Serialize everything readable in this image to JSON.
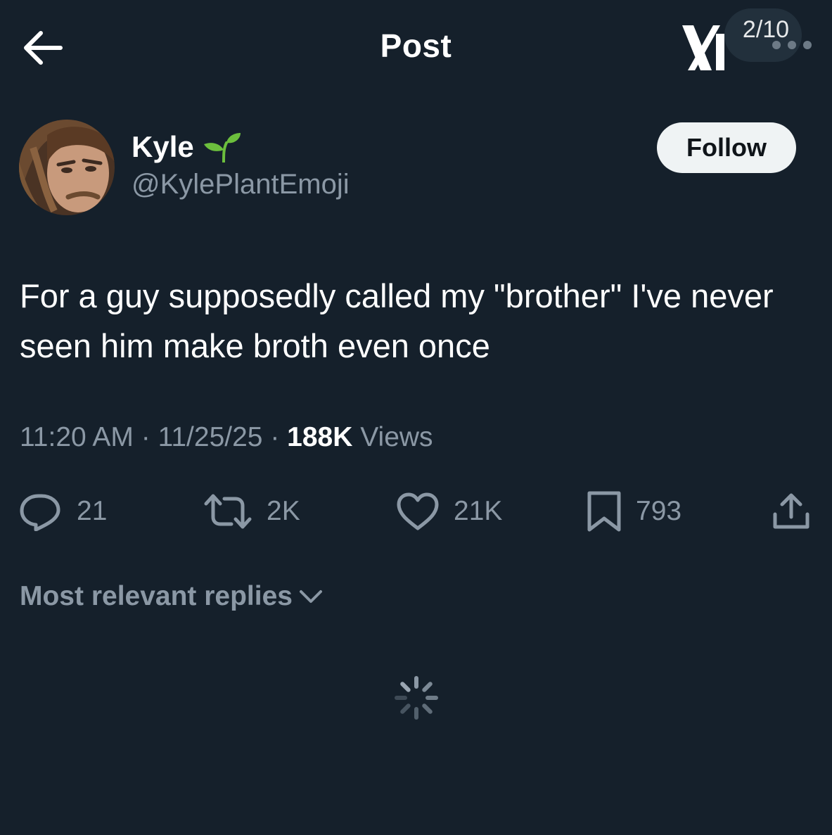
{
  "header": {
    "title": "Post",
    "back_icon": "arrow-left-icon",
    "logo_icon": "x-logo-icon",
    "media_counter": "2/10"
  },
  "author": {
    "name": "Kyle",
    "name_emoji": "seedling-icon",
    "handle": "@KylePlantEmoji",
    "follow_label": "Follow"
  },
  "post": {
    "text": "For a guy supposedly called my \"brother\" I've never seen him make broth even once"
  },
  "meta": {
    "time": "11:20 AM",
    "separator": " · ",
    "date": "11/25/25",
    "views_count": "188K",
    "views_label": " Views"
  },
  "actions": {
    "replies": "21",
    "reposts": "2K",
    "likes": "21K",
    "bookmarks": "793"
  },
  "replies_sort": {
    "label": "Most relevant replies"
  },
  "colors": {
    "background": "#15202b",
    "text_primary": "#ffffff",
    "text_secondary": "#8b98a5",
    "follow_button_bg": "#eff3f4",
    "follow_button_text": "#0f1419",
    "seedling_green": "#6cbf3d"
  }
}
